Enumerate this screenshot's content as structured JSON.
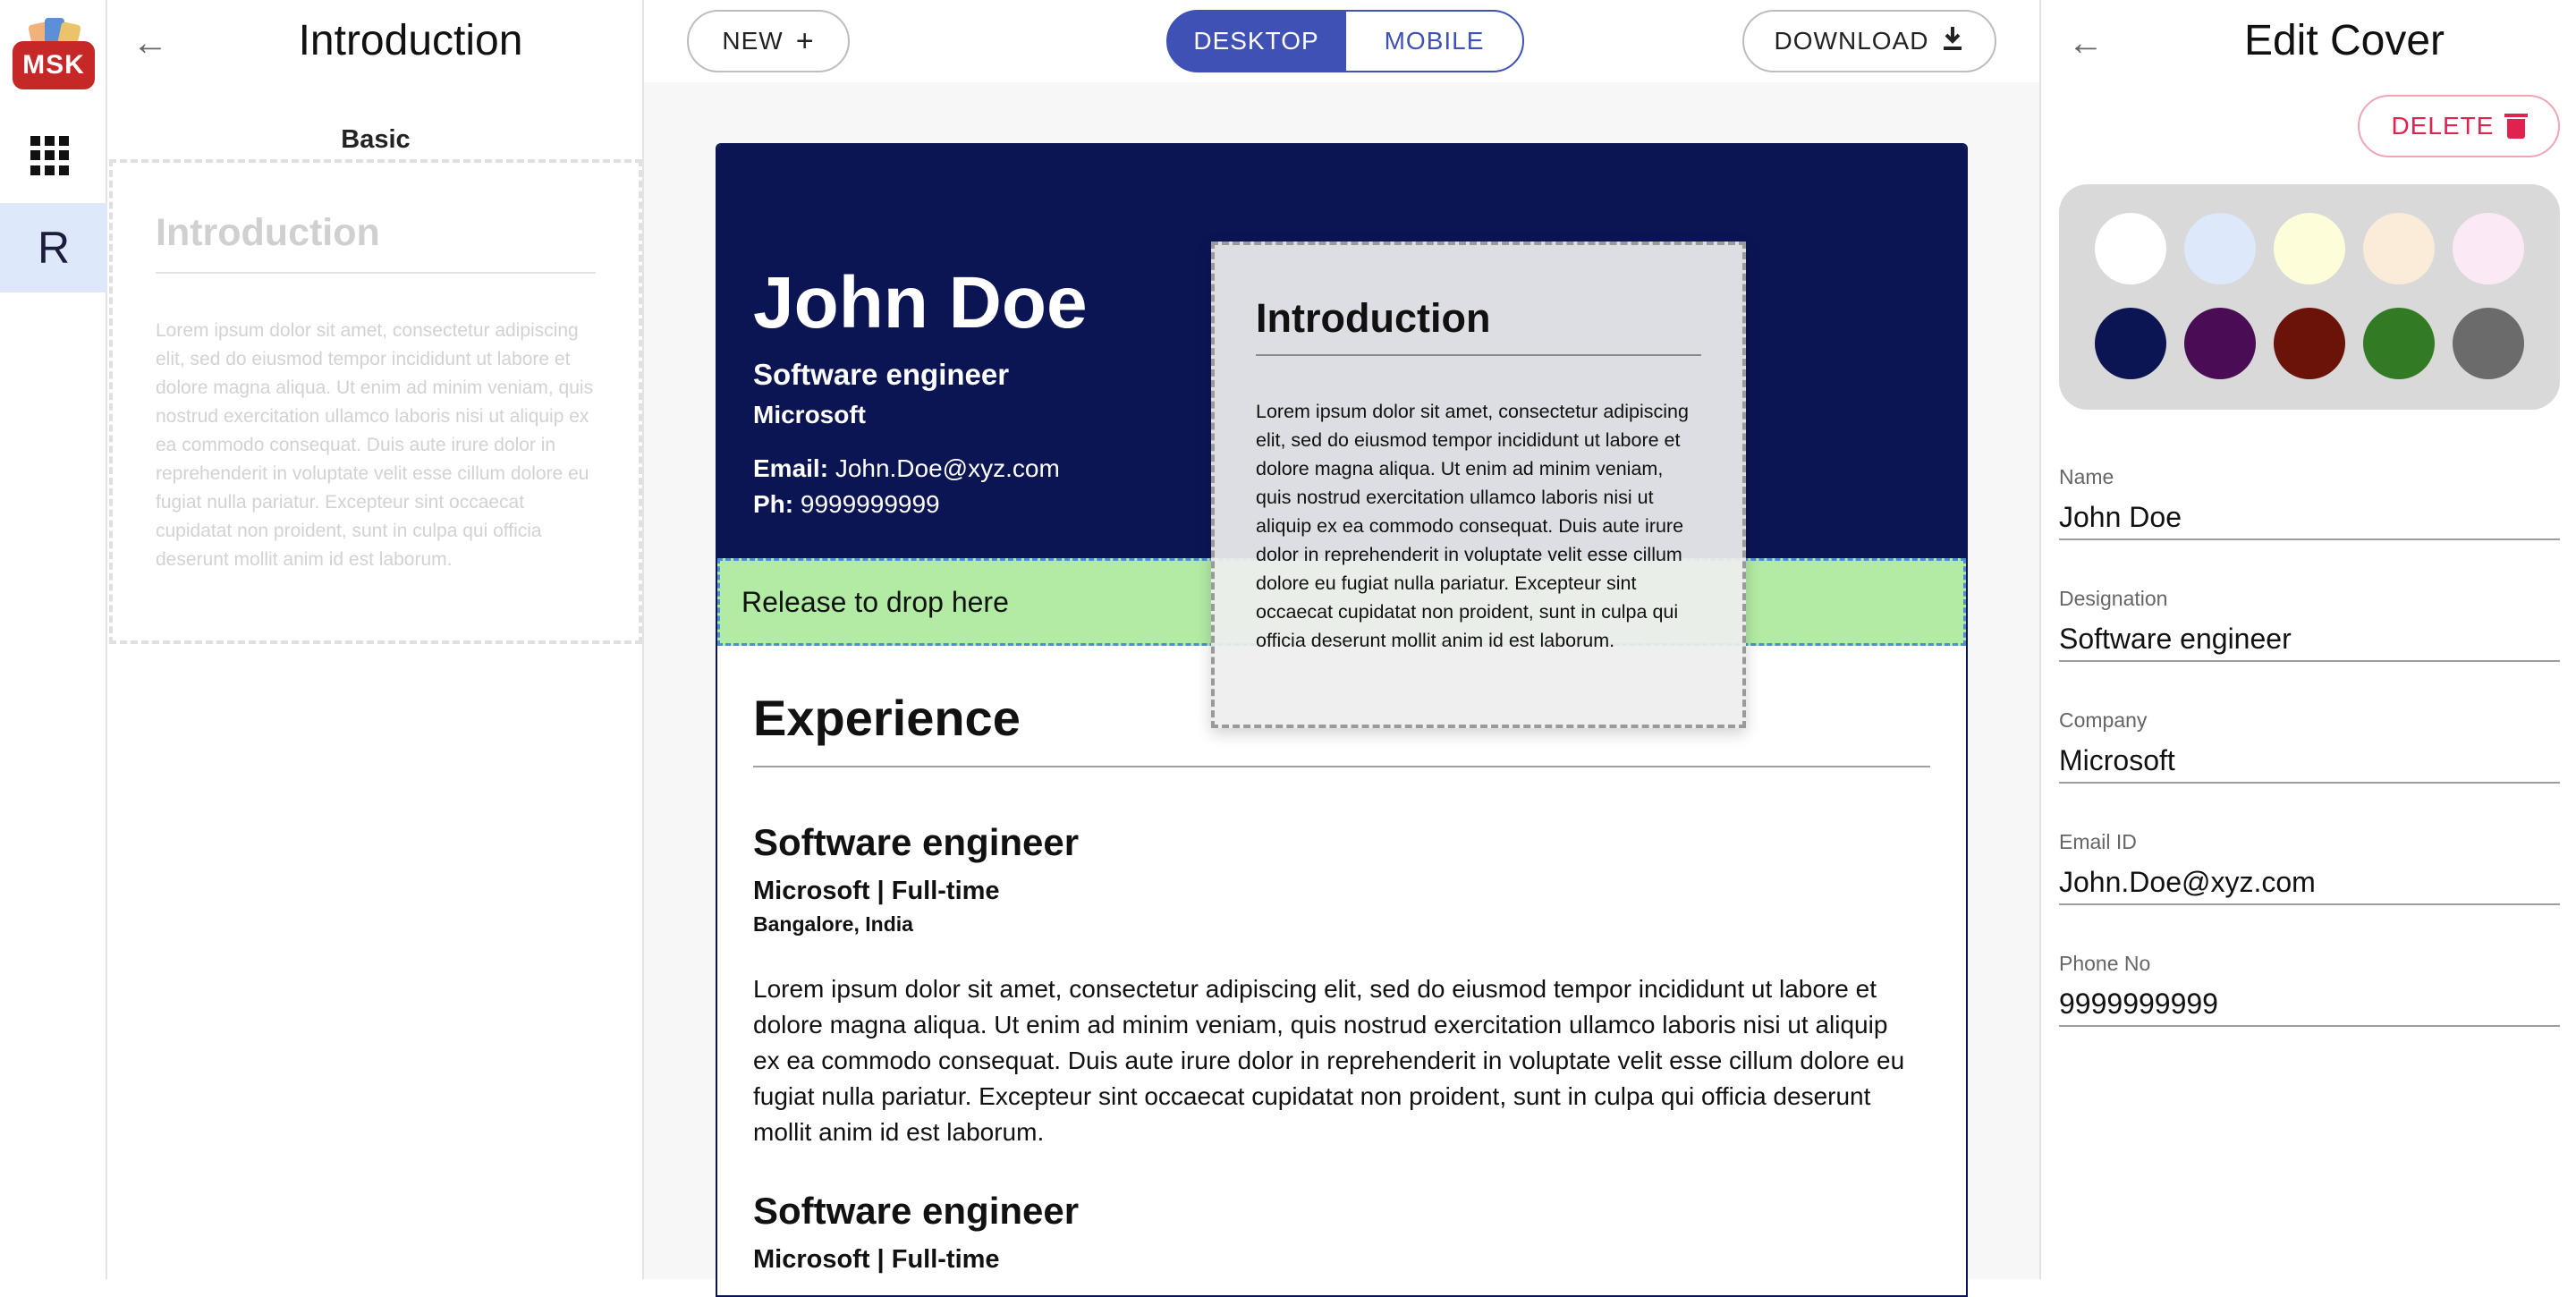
{
  "app": {
    "logo_text": "MSK",
    "rail_item_label": "R"
  },
  "sections_panel": {
    "title": "Introduction",
    "group_label": "Basic",
    "ghost_card": {
      "title": "Introduction",
      "body": "Lorem ipsum dolor sit amet, consectetur adipiscing elit, sed do eiusmod tempor incididunt ut labore et dolore magna aliqua. Ut enim ad minim veniam, quis nostrud exercitation ullamco laboris nisi ut aliquip ex ea commodo consequat. Duis aute irure dolor in reprehenderit in voluptate velit esse cillum dolore eu fugiat nulla pariatur. Excepteur sint occaecat cupidatat non proident, sunt in culpa qui officia deserunt mollit anim id est laborum."
    }
  },
  "toolbar": {
    "new_label": "NEW",
    "desktop_label": "DESKTOP",
    "mobile_label": "MOBILE",
    "active_view": "DESKTOP",
    "download_label": "DOWNLOAD"
  },
  "resume": {
    "cover": {
      "name": "John Doe",
      "designation": "Software engineer",
      "company": "Microsoft",
      "email_label": "Email:",
      "email": "John.Doe@xyz.com",
      "phone_label": "Ph:",
      "phone": "9999999999",
      "background": "#0b1553"
    },
    "dropzone_text": "Release to drop here",
    "experience": {
      "title": "Experience",
      "jobs": [
        {
          "title": "Software engineer",
          "company_line": "Microsoft | Full-time",
          "location": "Bangalore, India",
          "description": "Lorem ipsum dolor sit amet, consectetur adipiscing elit, sed do eiusmod tempor incididunt ut labore et dolore magna aliqua. Ut enim ad minim veniam, quis nostrud exercitation ullamco laboris nisi ut aliquip ex ea commodo consequat. Duis aute irure dolor in reprehenderit in voluptate velit esse cillum dolore eu fugiat nulla pariatur. Excepteur sint occaecat cupidatat non proident, sunt in culpa qui officia deserunt mollit anim id est laborum."
        },
        {
          "title": "Software engineer",
          "company_line": "Microsoft | Full-time"
        }
      ]
    }
  },
  "dragged_card": {
    "title": "Introduction",
    "body": "Lorem ipsum dolor sit amet, consectetur adipiscing elit, sed do eiusmod tempor incididunt ut labore et dolore magna aliqua. Ut enim ad minim veniam, quis nostrud exercitation ullamco laboris nisi ut aliquip ex ea commodo consequat. Duis aute irure dolor in reprehenderit in voluptate velit esse cillum dolore eu fugiat nulla pariatur. Excepteur sint occaecat cupidatat non proident, sunt in culpa qui officia deserunt mollit anim id est laborum."
  },
  "edit_panel": {
    "title": "Edit Cover",
    "delete_label": "DELETE",
    "colors": {
      "light": [
        "#ffffff",
        "#dde8fb",
        "#fdfdd9",
        "#fbebd9",
        "#fbeaf6"
      ],
      "dark": [
        "#0b1553",
        "#4a0d55",
        "#6b1308",
        "#327a23",
        "#6b6b6b"
      ]
    },
    "fields": [
      {
        "label": "Name",
        "value": "John Doe"
      },
      {
        "label": "Designation",
        "value": "Software engineer"
      },
      {
        "label": "Company",
        "value": "Microsoft"
      },
      {
        "label": "Email ID",
        "value": "John.Doe@xyz.com"
      },
      {
        "label": "Phone No",
        "value": "9999999999"
      }
    ]
  },
  "icons": {
    "back": "arrow-left-icon",
    "apps": "grid-icon",
    "add": "plus-icon",
    "download": "download-icon",
    "delete": "trash-icon"
  }
}
